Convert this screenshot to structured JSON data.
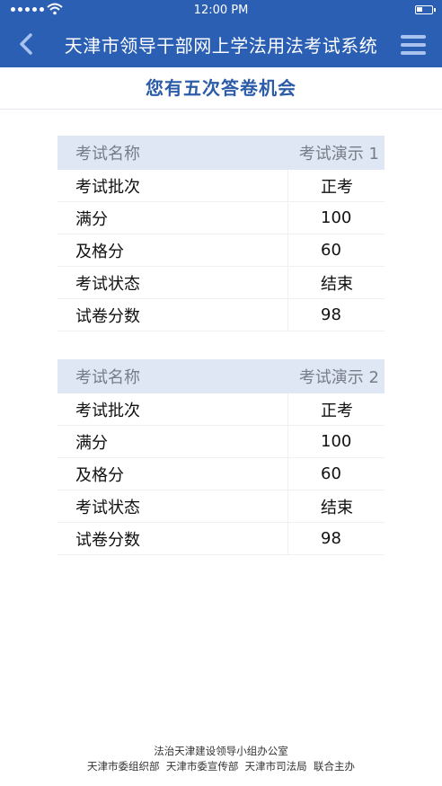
{
  "status": {
    "time": "12:00 PM"
  },
  "header": {
    "title": "天津市领导干部网上学法用法考试系统"
  },
  "banner": {
    "text": "您有五次答卷机会"
  },
  "exams": [
    {
      "name_label": "考试名称",
      "name_value": "考试演示 1",
      "rows": [
        {
          "label": "考试批次",
          "value": "正考"
        },
        {
          "label": "满分",
          "value": "100"
        },
        {
          "label": "及格分",
          "value": "60"
        },
        {
          "label": "考试状态",
          "value": "结束"
        },
        {
          "label": "试卷分数",
          "value": "98"
        }
      ]
    },
    {
      "name_label": "考试名称",
      "name_value": "考试演示 2",
      "rows": [
        {
          "label": "考试批次",
          "value": "正考"
        },
        {
          "label": "满分",
          "value": "100"
        },
        {
          "label": "及格分",
          "value": "60"
        },
        {
          "label": "考试状态",
          "value": "结束"
        },
        {
          "label": "试卷分数",
          "value": "98"
        }
      ]
    }
  ],
  "footer": {
    "line1": "法治天津建设领导小组办公室",
    "line2": "天津市委组织部  天津市委宣传部  天津市司法局  联合主办"
  },
  "colors": {
    "header_bg": "#2b5fb4",
    "accent": "#2c5ca8",
    "table_head_bg": "#dfe7f4"
  },
  "icons": [
    "back-chevron-icon",
    "menu-icon",
    "wifi-icon",
    "battery-icon"
  ]
}
